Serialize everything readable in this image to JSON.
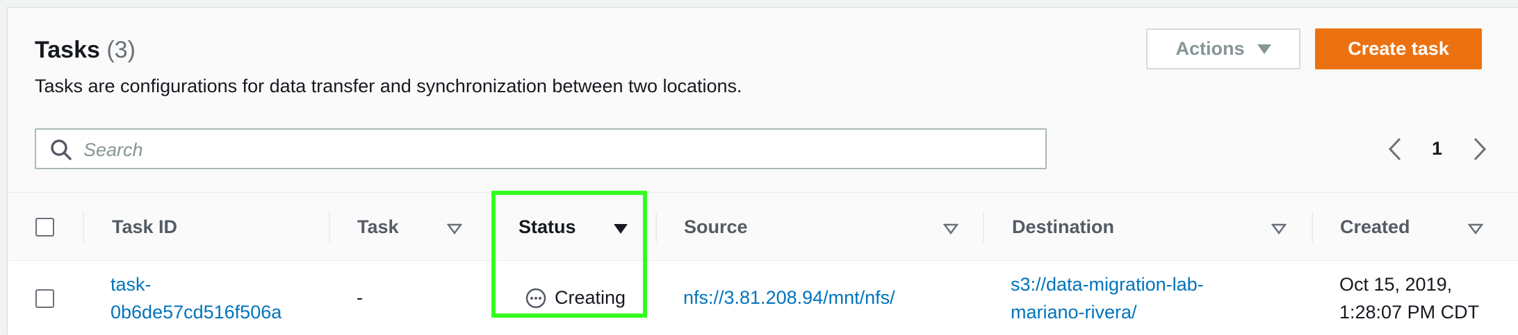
{
  "header": {
    "title": "Tasks",
    "count": "(3)",
    "description": "Tasks are configurations for data transfer and synchronization between two locations.",
    "actions_label": "Actions",
    "create_label": "Create task"
  },
  "search": {
    "placeholder": "Search"
  },
  "pagination": {
    "current_page": "1"
  },
  "table": {
    "columns": [
      "Task ID",
      "Task",
      "Status",
      "Source",
      "Destination",
      "Created"
    ],
    "sorted_column": "Status",
    "rows": [
      {
        "task_id_line1": "task-",
        "task_id_line2": "0b6de57cd516f506a",
        "task": "-",
        "status": "Creating",
        "source": "nfs://3.81.208.94/mnt/nfs/",
        "destination_line1": "s3://data-migration-lab-",
        "destination_line2": "mariano-rivera/",
        "created_line1": "Oct 15, 2019,",
        "created_line2": "1:28:07 PM CDT"
      }
    ]
  },
  "colors": {
    "accent": "#ec7211",
    "link": "#0073bb",
    "highlight": "#33ff1f"
  }
}
